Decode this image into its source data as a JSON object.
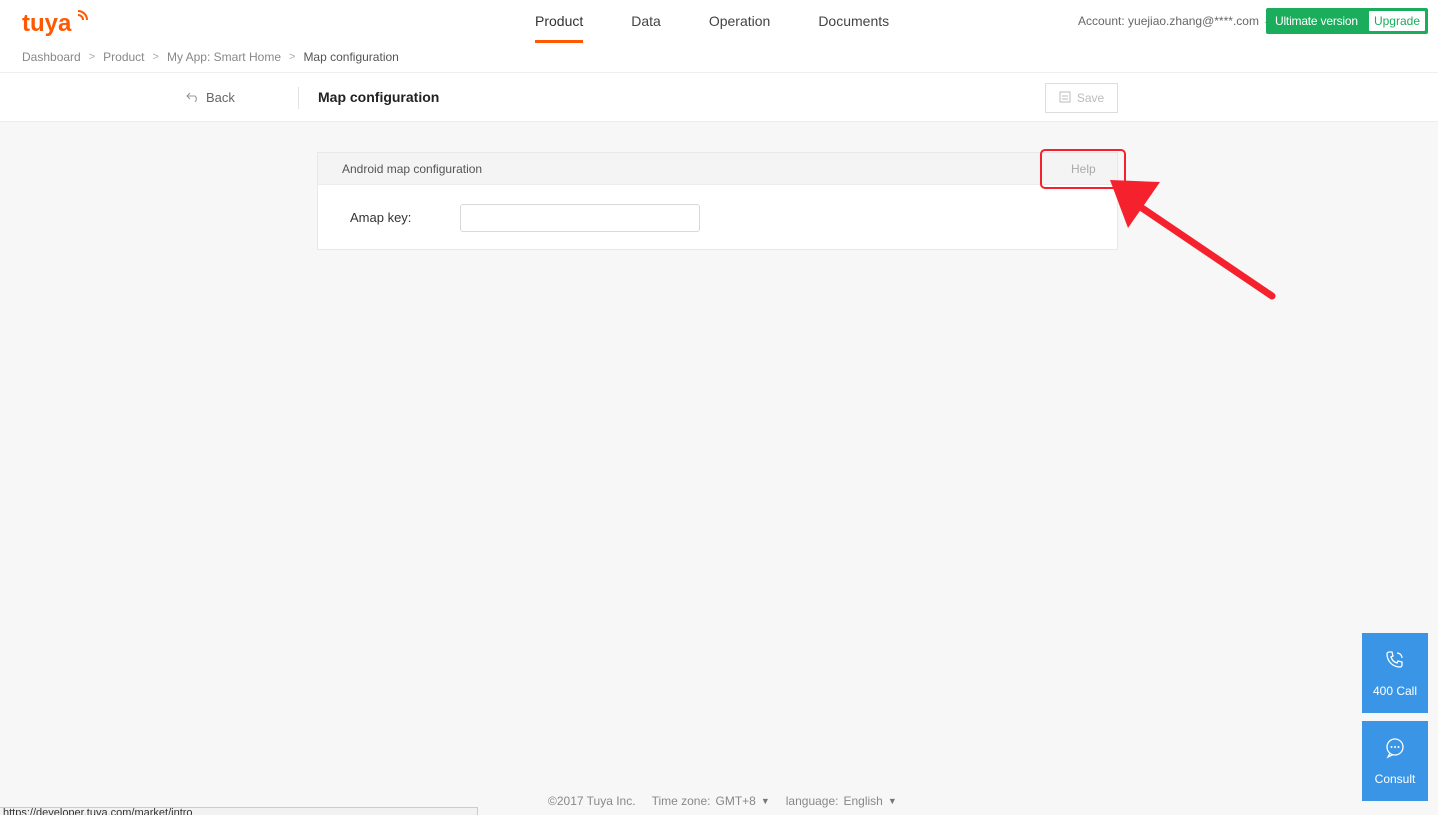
{
  "header": {
    "logo_text": "tuya",
    "nav": [
      {
        "label": "Product",
        "active": true
      },
      {
        "label": "Data",
        "active": false
      },
      {
        "label": "Operation",
        "active": false
      },
      {
        "label": "Documents",
        "active": false
      }
    ],
    "account": "Account: yuejiao.zhang@****.com",
    "plan_label": "Ultimate version",
    "upgrade_label": "Upgrade"
  },
  "breadcrumb": [
    "Dashboard",
    "Product",
    "My App: Smart Home",
    "Map configuration"
  ],
  "subheader": {
    "back_label": "Back",
    "title": "Map configuration",
    "save_label": "Save"
  },
  "card": {
    "title": "Android map configuration",
    "help_label": "Help",
    "field_label": "Amap key:",
    "field_value": "",
    "field_placeholder": ""
  },
  "floating": {
    "call_label": "400 Call",
    "consult_label": "Consult"
  },
  "footer": {
    "copyright": "©2017 Tuya Inc.",
    "timezone_label": "Time zone:",
    "timezone_value": "GMT+8",
    "language_label": "language:",
    "language_value": "English"
  },
  "status_url": "https://developer.tuya.com/market/intro",
  "colors": {
    "accent": "#ff5800",
    "plan_green": "#1aad5b",
    "float_blue": "#3b95e6",
    "annotation_red": "#f5222d"
  }
}
